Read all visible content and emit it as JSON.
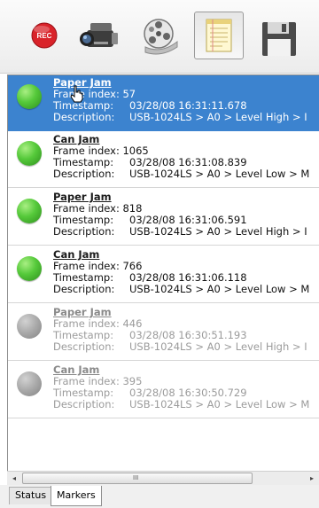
{
  "toolbar": {
    "record_label": "REC",
    "buttons": [
      "record-icon",
      "video-camera-icon",
      "film-reel-icon",
      "notepad-icon",
      "floppy-disk-icon"
    ]
  },
  "labels": {
    "frame_index": "Frame index:",
    "timestamp": "Timestamp:",
    "description": "Description:"
  },
  "markers": [
    {
      "title": "Paper Jam",
      "frame_index": "57",
      "timestamp": "03/28/08 16:31:11.678",
      "description": "USB-1024LS > A0 > Level High > I",
      "status": "green",
      "selected": true
    },
    {
      "title": "Can Jam",
      "frame_index": "1065",
      "timestamp": "03/28/08 16:31:08.839",
      "description": "USB-1024LS > A0 > Level Low > M",
      "status": "green",
      "selected": false
    },
    {
      "title": "Paper Jam",
      "frame_index": "818",
      "timestamp": "03/28/08 16:31:06.591",
      "description": "USB-1024LS > A0 > Level High > I",
      "status": "green",
      "selected": false
    },
    {
      "title": "Can Jam",
      "frame_index": "766",
      "timestamp": "03/28/08 16:31:06.118",
      "description": "USB-1024LS > A0 > Level Low > M",
      "status": "green",
      "selected": false
    },
    {
      "title": "Paper Jam",
      "frame_index": "446",
      "timestamp": "03/28/08 16:30:51.193",
      "description": "USB-1024LS > A0 > Level High > I",
      "status": "gray",
      "selected": false
    },
    {
      "title": "Can Jam",
      "frame_index": "395",
      "timestamp": "03/28/08 16:30:50.729",
      "description": "USB-1024LS > A0 > Level Low > M",
      "status": "gray",
      "selected": false
    }
  ],
  "scrollbar": {
    "left_arrow": "◂",
    "right_arrow": "▸",
    "grip": "III"
  },
  "tabs": {
    "status": "Status",
    "markers": "Markers"
  },
  "colors": {
    "selection": "#3c83cf",
    "green_dot": "#55c93a",
    "gray_dot": "#a8a8a8",
    "record": "#d9232a"
  }
}
